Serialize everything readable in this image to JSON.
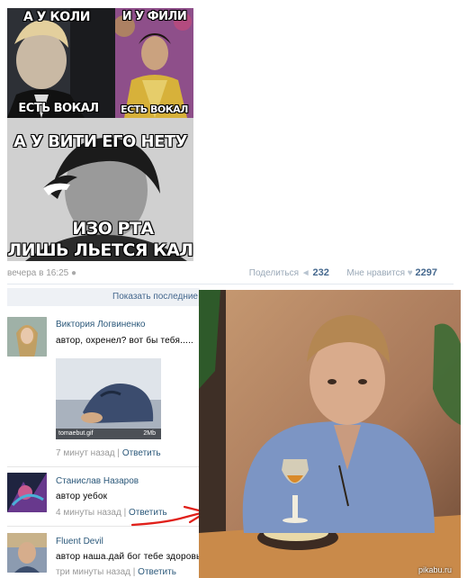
{
  "meme": {
    "top_left_caption": "А У КОЛИ",
    "top_left_bottom": "ЕСТЬ ВОКАЛ",
    "top_right_caption": "И У ФИЛИ",
    "top_right_bottom": "ЕСТЬ ВОКАЛ",
    "middle_caption": "А У ВИТИ ЕГО НЕТУ",
    "bottom_line1": "ИЗО РТА",
    "bottom_line2": "ЛИШЬ ЛЬЕТСЯ КАЛ"
  },
  "post_meta": {
    "time": "вечера в 16:25",
    "share_label": "Поделиться",
    "share_count": "232",
    "like_label": "Мне нравится",
    "like_count": "2297"
  },
  "comments_header": {
    "show_previous": "Показать последние"
  },
  "comments": [
    {
      "author": "Виктория Логвиненко",
      "text": "автор, охренел? вот бы тебя.....",
      "attachment": {
        "filename": "tomaebut.gif",
        "size": "2Mb"
      },
      "time": "7 минут назад",
      "reply": "Ответить"
    },
    {
      "author": "Станислав Назаров",
      "text": "автор уебок",
      "time": "4 минуты назад",
      "reply": "Ответить"
    },
    {
      "author": "Fluent Devil",
      "text": "автор наша.дай бог тебе здоровья",
      "time": "три минуты назад",
      "reply": "Ответить"
    }
  ],
  "watermark": "pikabu.ru",
  "colors": {
    "link": "#2b587a",
    "accent_red": "#e0201a",
    "meta_gray": "#999999"
  }
}
